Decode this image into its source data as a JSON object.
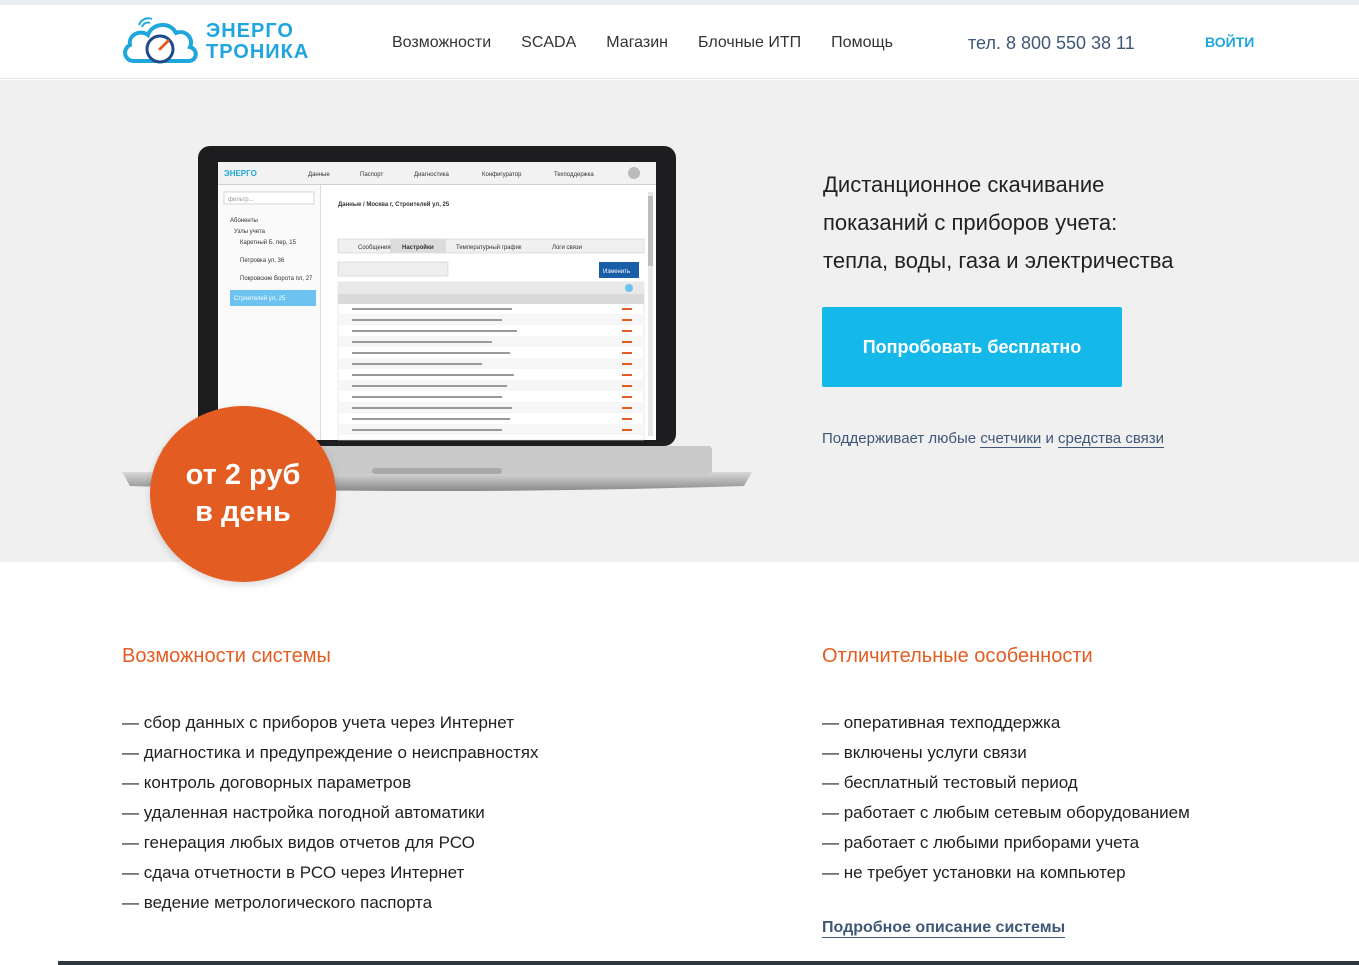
{
  "header": {
    "logo_line1": "ЭНЕРГО",
    "logo_line2": "ТРОНИКА",
    "nav": [
      "Возможности",
      "SCADA",
      "Магазин",
      "Блочные ИТП",
      "Помощь"
    ],
    "phone": "тел. 8 800 550 38 11",
    "login": "ВОЙТИ"
  },
  "hero": {
    "title_lines": [
      "Дистанционное скачивание",
      "показаний с приборов учета:",
      "тепла, воды, газа и электричества"
    ],
    "cta": "Попробовать бесплатно",
    "support_prefix": "Поддерживает любые ",
    "support_link1": "счетчики",
    "support_mid": " и ",
    "support_link2": "средства связи",
    "badge_line1": "от 2 руб",
    "badge_line2": "в день"
  },
  "screen": {
    "tabs": [
      "Данные",
      "Паспорт",
      "Диагностика",
      "Конфигуратор",
      "Техподдержка"
    ],
    "filter_placeholder": "фильтр...",
    "tree": [
      "Абоненты",
      "Узлы учета",
      "Каретный Б. пер, 15",
      "Петровка ул, 36",
      "Покровские Ворота пл, 27",
      "Строителей ул, 25"
    ],
    "breadcrumb": "Данные / Москва г, Строителей ул, 25",
    "subtabs": [
      "Сообщения",
      "Настройки",
      "Температурный график",
      "Логи связи"
    ],
    "button": "Изменить"
  },
  "features_left": {
    "title": "Возможности системы",
    "items": [
      "— сбор данных с приборов учета через Интернет",
      "— диагностика и предупреждение о неисправностях",
      "— контроль договорных параметров",
      "— удаленная настройка погодной автоматики",
      "— генерация любых видов отчетов для РСО",
      "— сдача отчетности в РСО через Интернет",
      "— ведение метрологического паспорта"
    ]
  },
  "features_right": {
    "title": "Отличительные особенности",
    "items": [
      "— оперативная техподдержка",
      "— включены услуги связи",
      "— бесплатный тестовый период",
      "— работает с любым сетевым оборудованием",
      "— работает с любыми приборами учета",
      "— не требует установки на компьютер"
    ],
    "details_link": "Подробное описание системы"
  },
  "colors": {
    "accent": "#14b9ea",
    "orange": "#e35d22",
    "brand": "#1fa7dd",
    "navy": "#3f5877"
  }
}
